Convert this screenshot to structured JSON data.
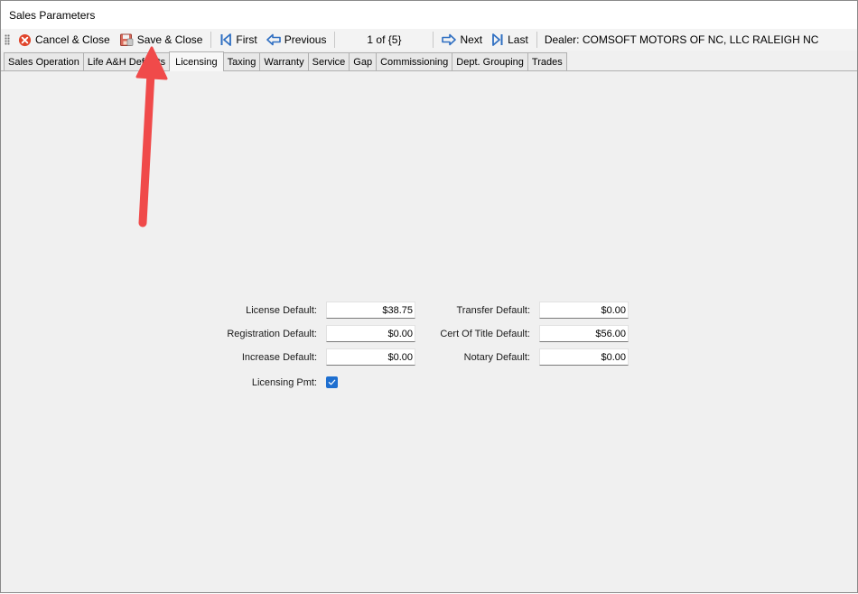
{
  "window": {
    "title": "Sales Parameters"
  },
  "toolbar": {
    "cancel_label": "Cancel & Close",
    "save_label": "Save & Close",
    "first_label": "First",
    "previous_label": "Previous",
    "record_position": "1 of {5}",
    "next_label": "Next",
    "last_label": "Last",
    "dealer_text": "Dealer: COMSOFT MOTORS OF NC, LLC RALEIGH NC"
  },
  "tabs": [
    {
      "label": "Sales Operation"
    },
    {
      "label": "Life A&H Defaults"
    },
    {
      "label": "Licensing"
    },
    {
      "label": "Taxing"
    },
    {
      "label": "Warranty"
    },
    {
      "label": "Service"
    },
    {
      "label": "Gap"
    },
    {
      "label": "Commissioning"
    },
    {
      "label": "Dept. Grouping"
    },
    {
      "label": "Trades"
    }
  ],
  "active_tab": "Licensing",
  "licensing": {
    "license_default_label": "License Default:",
    "license_default_value": "$38.75",
    "registration_default_label": "Registration Default:",
    "registration_default_value": "$0.00",
    "increase_default_label": "Increase Default:",
    "increase_default_value": "$0.00",
    "transfer_default_label": "Transfer Default:",
    "transfer_default_value": "$0.00",
    "cert_of_title_default_label": "Cert Of Title Default:",
    "cert_of_title_default_value": "$56.00",
    "notary_default_label": "Notary Default:",
    "notary_default_value": "$0.00",
    "licensing_pmt_label": "Licensing Pmt:",
    "licensing_pmt_checked": true
  },
  "colors": {
    "accent": "#1e6fd0",
    "annotation_arrow": "#f04a4a",
    "cancel_icon": "#e0452b"
  }
}
